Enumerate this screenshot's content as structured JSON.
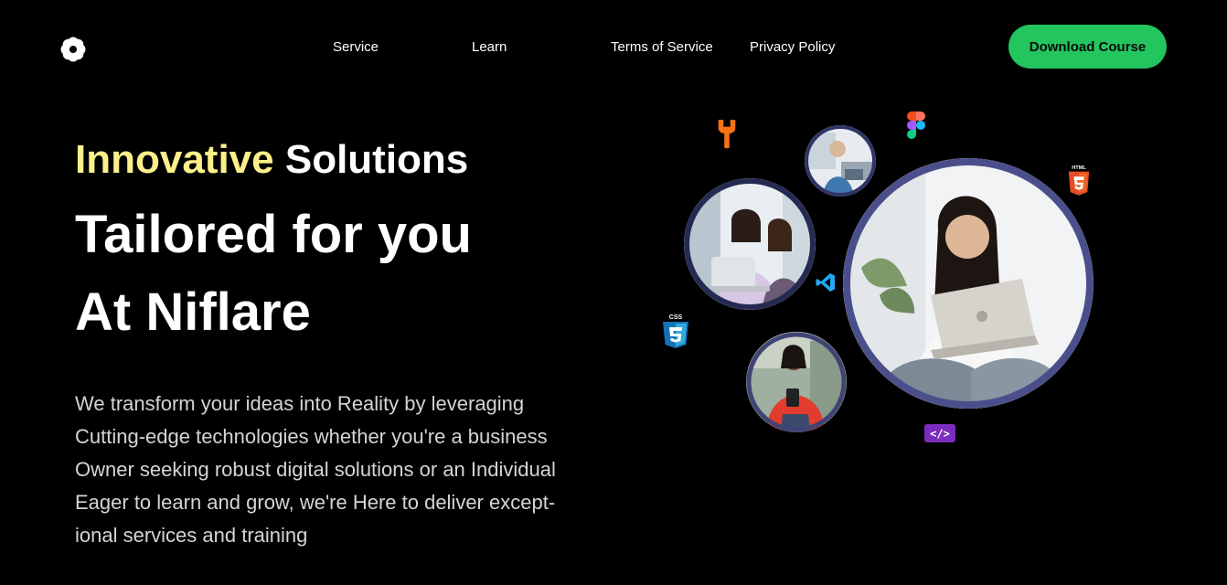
{
  "header": {
    "logo_icon": "flower-icon",
    "nav": {
      "service": "Service",
      "learn": "Learn",
      "terms": "Terms of Service",
      "privacy": "Privacy Policy"
    },
    "cta_label": "Download Course"
  },
  "hero": {
    "line1_accent": "Innovative",
    "line1_rest": " Solutions",
    "line2": "Tailored for you",
    "line3": "At Niflare",
    "description_lines": [
      "We transform your ideas into Reality by leveraging",
      "Cutting-edge technologies whether you're a business",
      "Owner seeking robust digital solutions or an Individual",
      "Eager to learn and grow, we're Here to deliver except-",
      "ional services and training"
    ]
  },
  "illustration": {
    "icons": [
      "wrench-icon",
      "figma-icon",
      "html5-icon",
      "vscode-icon",
      "css3-icon",
      "code-tag-icon"
    ],
    "badge_html": "HTML",
    "badge_css": "CSS",
    "code_tag": "</>"
  },
  "colors": {
    "background": "#000000",
    "accent_yellow": "#fdf08a",
    "cta_green": "#22c55e",
    "ring": "#4a4f8c"
  }
}
